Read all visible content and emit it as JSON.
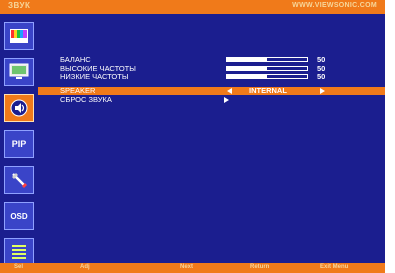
{
  "header": {
    "title": "ЗВУК",
    "url": "WWW.VIEWSONIC.COM"
  },
  "sidebar": {
    "items": [
      {
        "icon": "color-bars-icon"
      },
      {
        "icon": "monitor-icon"
      },
      {
        "icon": "speaker-icon",
        "active": true
      },
      {
        "icon": "pip-icon",
        "label": "PIP"
      },
      {
        "icon": "tools-icon"
      },
      {
        "icon": "osd-icon",
        "label": "OSD"
      },
      {
        "icon": "list-icon"
      }
    ]
  },
  "menu": {
    "items": [
      {
        "label": "БАЛАНС",
        "value": "50",
        "level": 0.5
      },
      {
        "label": "ВЫСОКИЕ ЧАСТОТЫ",
        "value": "50",
        "level": 0.5
      },
      {
        "label": "НИЗКИЕ ЧАСТОТЫ",
        "value": "50",
        "level": 0.5
      },
      {
        "label": "SPEAKER",
        "value": "INTERNAL",
        "selected": true
      },
      {
        "label": "СБРОС ЗВУКА"
      }
    ]
  },
  "footer": {
    "sel": "Sel",
    "adj": "Adj",
    "next": "Next",
    "return": "Return",
    "exit": "Exit Menu"
  },
  "colors": {
    "background": "#1b1e8f",
    "accent": "#f07a1a"
  }
}
